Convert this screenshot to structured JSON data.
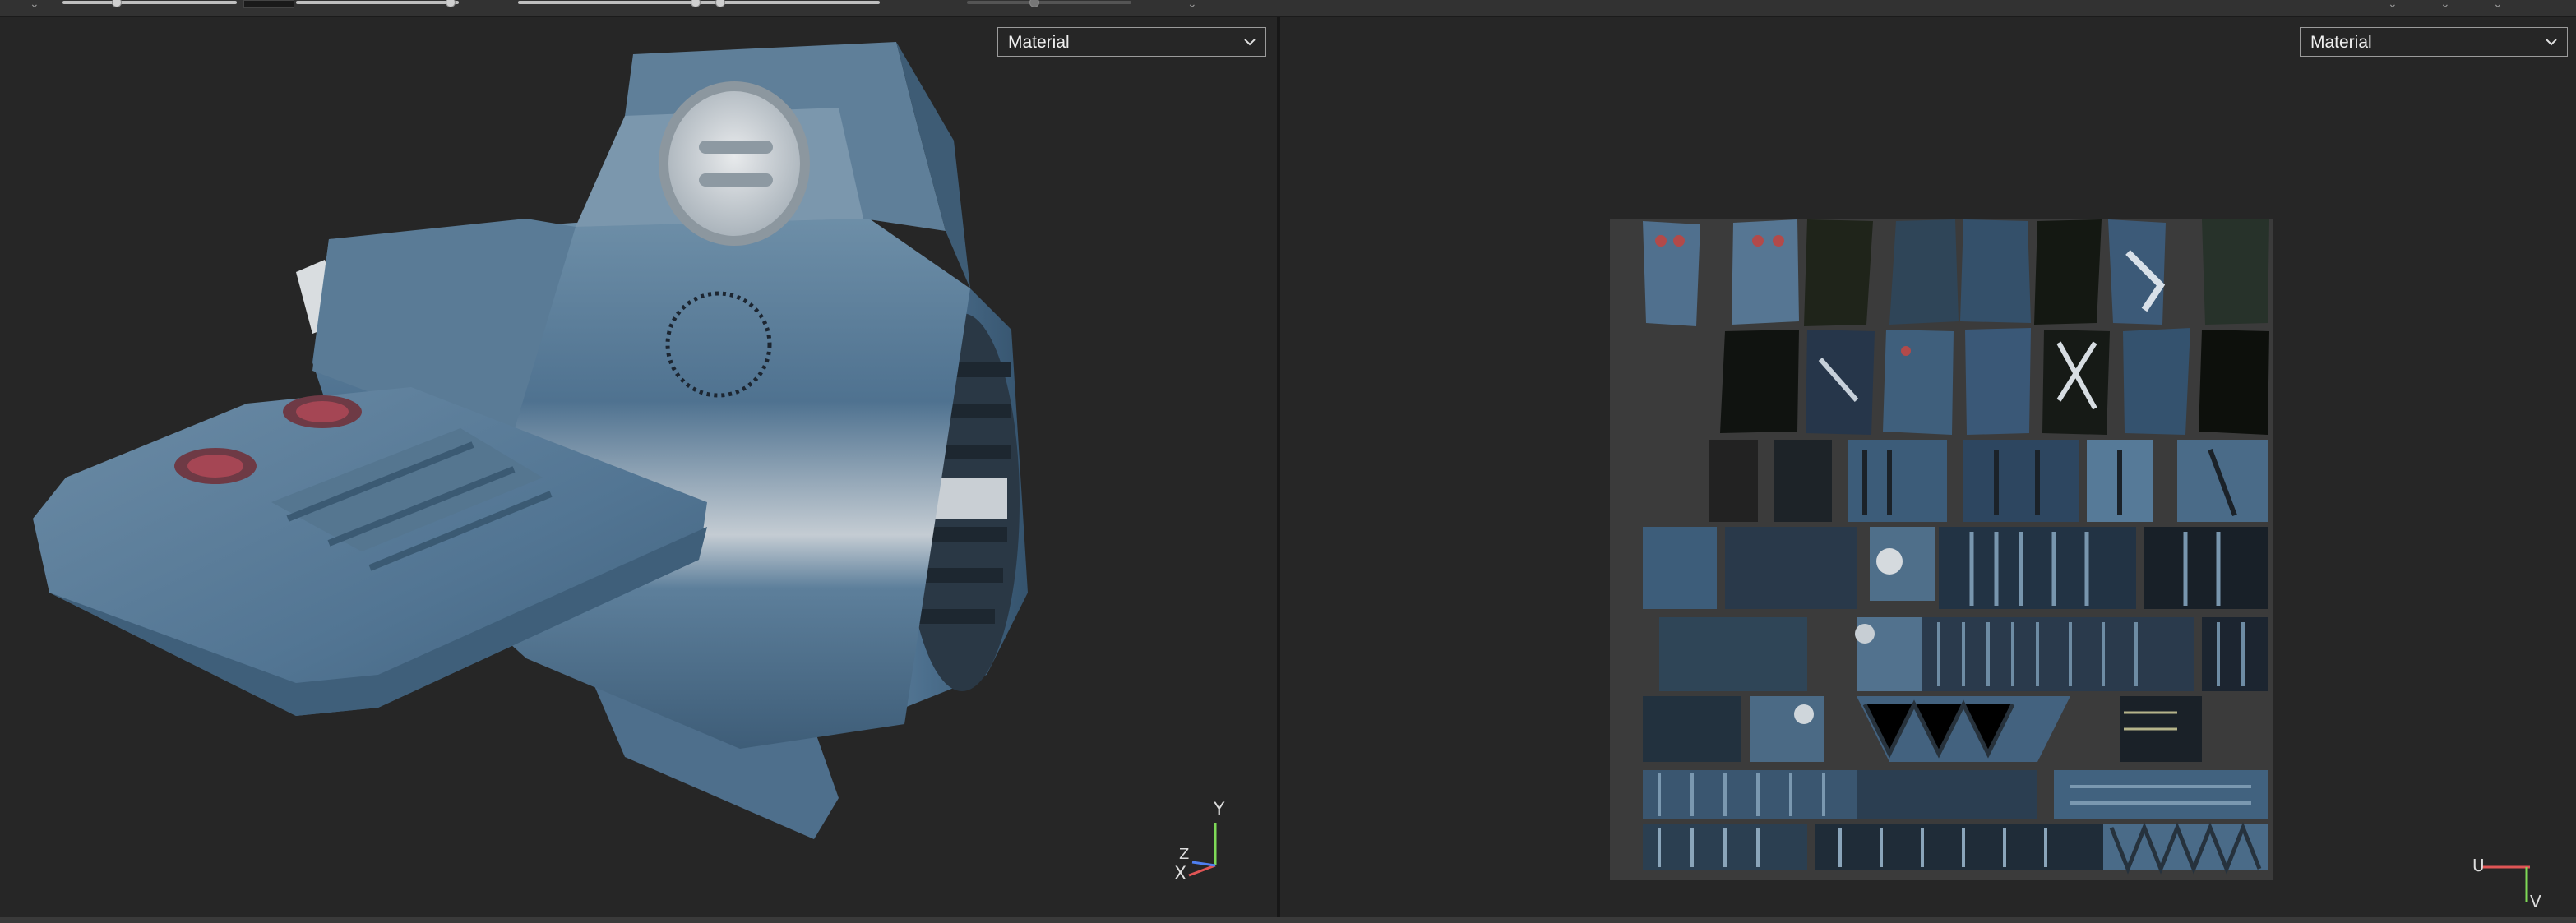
{
  "viewport_3d": {
    "shading_mode": "Material",
    "axis_labels": {
      "y": "Y",
      "z": "Z",
      "x": "X"
    },
    "colors": {
      "axis_x": "#e05555",
      "axis_y": "#7ed957",
      "axis_z": "#4f7ff0",
      "model_base": "#5b7c97"
    }
  },
  "viewport_uv": {
    "shading_mode": "Material",
    "axis_labels": {
      "u": "U",
      "v": "V"
    },
    "colors": {
      "axis_u": "#e05555",
      "axis_v": "#7ed957",
      "atlas_bg": "#3b3b3b"
    }
  },
  "icons": {
    "dropdown": "chevron-down-icon",
    "gizmo_3d": "axis-gizmo-icon",
    "gizmo_uv": "uv-axis-icon"
  }
}
